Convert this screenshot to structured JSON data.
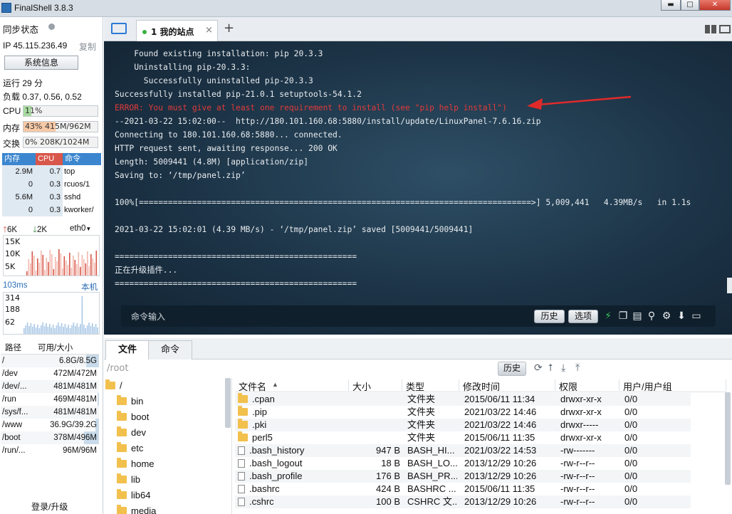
{
  "window": {
    "title": "FinalShell 3.8.3",
    "min_label": "▬",
    "max_label": "□",
    "close_label": "✕"
  },
  "left": {
    "sync_label": "同步状态",
    "ip_label": "IP 45.115.236.49",
    "copy_label": "复制",
    "sysinfo_button": "系统信息",
    "uptime": "运行 29 分",
    "load": "负载 0.37, 0.56, 0.52",
    "cpu_label": "CPU",
    "cpu_value": "11%",
    "cpu_fraction": 0.11,
    "mem_label": "内存",
    "mem_value": "43% 415M/962M",
    "mem_fraction": 0.43,
    "swap_label": "交换",
    "swap_value": "0% 208K/1024M",
    "swap_fraction": 0.0,
    "proc_headers": [
      "内存",
      "CPU",
      "命令"
    ],
    "processes": [
      {
        "mem": "2.9M",
        "cpu": "0.7",
        "cmd": "top"
      },
      {
        "mem": "0",
        "cpu": "0.3",
        "cmd": "rcuos/1"
      },
      {
        "mem": "5.6M",
        "cpu": "0.3",
        "cmd": "sshd"
      },
      {
        "mem": "0",
        "cpu": "0.3",
        "cmd": "kworker/"
      }
    ],
    "net_up": "6K",
    "net_down": "2K",
    "net_iface": "eth0",
    "net_ticks": [
      "15K",
      "10K",
      "5K"
    ],
    "latency": "103ms",
    "latency_host": "本机",
    "latency_ticks": [
      "314",
      "188",
      "62"
    ],
    "disk_headers": [
      "路径",
      "可用/大小"
    ],
    "disks": [
      {
        "path": "/",
        "size": "6.8G/8.5G",
        "fraction": 0.2
      },
      {
        "path": "/dev",
        "size": "472M/472M",
        "fraction": 0.0
      },
      {
        "path": "/dev/...",
        "size": "481M/481M",
        "fraction": 0.0
      },
      {
        "path": "/run",
        "size": "469M/481M",
        "fraction": 0.02
      },
      {
        "path": "/sys/f...",
        "size": "481M/481M",
        "fraction": 0.0
      },
      {
        "path": "/www",
        "size": "36.9G/39.2G",
        "fraction": 0.06
      },
      {
        "path": "/boot",
        "size": "378M/496M",
        "fraction": 0.24
      },
      {
        "path": "/run/...",
        "size": "96M/96M",
        "fraction": 0.0
      }
    ],
    "login_label": "登录/升级"
  },
  "tabs": {
    "active": "1 我的站点",
    "close": "×",
    "add": "+"
  },
  "terminal": {
    "lines": [
      {
        "text": "    Found existing installation: pip 20.3.3",
        "error": false
      },
      {
        "text": "    Uninstalling pip-20.3.3:",
        "error": false
      },
      {
        "text": "      Successfully uninstalled pip-20.3.3",
        "error": false
      },
      {
        "text": "Successfully installed pip-21.0.1 setuptools-54.1.2",
        "error": false
      },
      {
        "text": "ERROR: You must give at least one requirement to install (see \"pip help install\")",
        "error": true
      },
      {
        "text": "--2021-03-22 15:02:00--  http://180.101.160.68:5880/install/update/LinuxPanel-7.6.16.zip",
        "error": false
      },
      {
        "text": "Connecting to 180.101.160.68:5880... connected.",
        "error": false
      },
      {
        "text": "HTTP request sent, awaiting response... 200 OK",
        "error": false
      },
      {
        "text": "Length: 5009441 (4.8M) [application/zip]",
        "error": false
      },
      {
        "text": "Saving to: ‘/tmp/panel.zip’",
        "error": false
      },
      {
        "text": "",
        "error": false
      },
      {
        "text": "100%[=================================================================================>] 5,009,441   4.39MB/s   in 1.1s",
        "error": false
      },
      {
        "text": "",
        "error": false
      },
      {
        "text": "2021-03-22 15:02:01 (4.39 MB/s) - ‘/tmp/panel.zip’ saved [5009441/5009441]",
        "error": false
      },
      {
        "text": "",
        "error": false
      },
      {
        "text": "==================================================",
        "error": false
      },
      {
        "text": "正在升级插件...",
        "error": false
      },
      {
        "text": "==================================================",
        "error": false
      }
    ],
    "cmd_label": "命令输入",
    "history_button": "历史",
    "options_button": "选项"
  },
  "bottom": {
    "tab_files": "文件",
    "tab_cmd": "命令",
    "path": "/root",
    "history_button": "历史",
    "tree_root": "/",
    "tree": [
      "bin",
      "boot",
      "dev",
      "etc",
      "home",
      "lib",
      "lib64",
      "media"
    ],
    "columns": [
      "文件名",
      "大小",
      "类型",
      "修改时间",
      "权限",
      "用户/用户组"
    ],
    "files": [
      {
        "name": ".cpan",
        "size": "",
        "type": "文件夹",
        "mtime": "2015/06/11 11:34",
        "perm": "drwxr-xr-x",
        "owner": "0/0",
        "dir": true
      },
      {
        "name": ".pip",
        "size": "",
        "type": "文件夹",
        "mtime": "2021/03/22 14:46",
        "perm": "drwxr-xr-x",
        "owner": "0/0",
        "dir": true
      },
      {
        "name": ".pki",
        "size": "",
        "type": "文件夹",
        "mtime": "2021/03/22 14:46",
        "perm": "drwxr-----",
        "owner": "0/0",
        "dir": true
      },
      {
        "name": "perl5",
        "size": "",
        "type": "文件夹",
        "mtime": "2015/06/11 11:35",
        "perm": "drwxr-xr-x",
        "owner": "0/0",
        "dir": true
      },
      {
        "name": ".bash_history",
        "size": "947 B",
        "type": "BASH_HI...",
        "mtime": "2021/03/22 14:53",
        "perm": "-rw-------",
        "owner": "0/0",
        "dir": false
      },
      {
        "name": ".bash_logout",
        "size": "18 B",
        "type": "BASH_LO...",
        "mtime": "2013/12/29 10:26",
        "perm": "-rw-r--r--",
        "owner": "0/0",
        "dir": false
      },
      {
        "name": ".bash_profile",
        "size": "176 B",
        "type": "BASH_PR...",
        "mtime": "2013/12/29 10:26",
        "perm": "-rw-r--r--",
        "owner": "0/0",
        "dir": false
      },
      {
        "name": ".bashrc",
        "size": "424 B",
        "type": "BASHRC ...",
        "mtime": "2015/06/11 11:35",
        "perm": "-rw-r--r--",
        "owner": "0/0",
        "dir": false
      },
      {
        "name": ".cshrc",
        "size": "100 B",
        "type": "CSHRC 文...",
        "mtime": "2013/12/29 10:26",
        "perm": "-rw-r--r--",
        "owner": "0/0",
        "dir": false
      }
    ]
  },
  "colors": {
    "accent": "#2d7bd6",
    "error": "#e03a3a",
    "arrow": "#e02a2a",
    "mem_header": "#d8574a",
    "cpu_header": "#d8574a",
    "cmd_header": "#3b86cf"
  }
}
